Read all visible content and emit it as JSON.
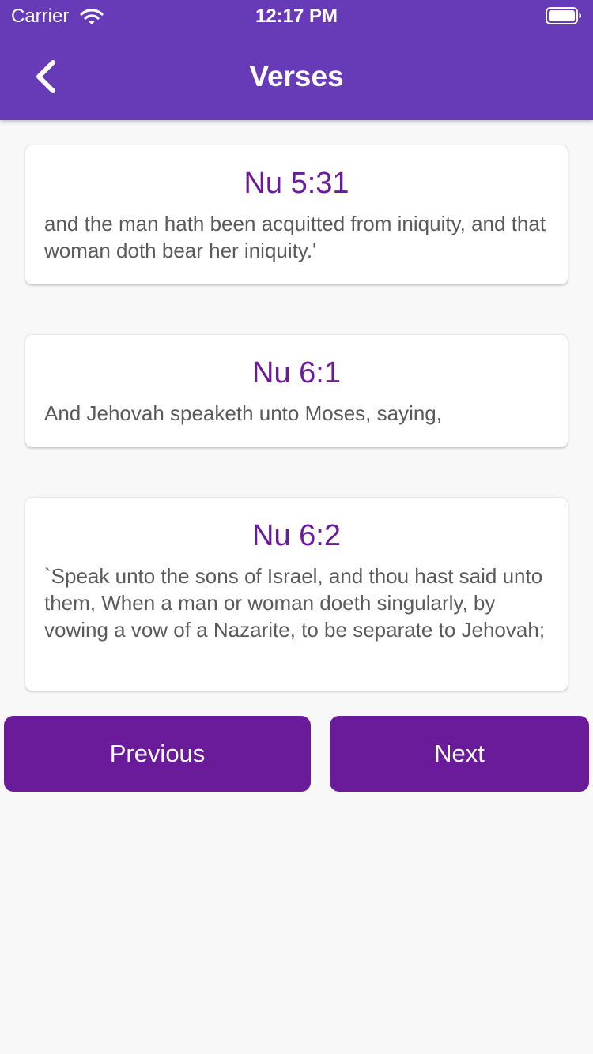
{
  "status_bar": {
    "carrier": "Carrier",
    "time": "12:17 PM",
    "wifi_icon": "wifi-icon",
    "battery_icon": "battery-icon"
  },
  "header": {
    "title": "Verses",
    "back_icon": "chevron-left-icon",
    "background": "#673ab7"
  },
  "verses": [
    {
      "reference": "Nu 5:31",
      "text": "and the man hath been acquitted from iniquity, and that woman doth bear her iniquity.'"
    },
    {
      "reference": "Nu 6:1",
      "text": "And Jehovah speaketh unto Moses, saying,"
    },
    {
      "reference": "Nu 6:2",
      "text": "`Speak unto the sons of Israel, and thou hast said unto them, When a man or woman doeth singularly, by vowing a vow of a Nazarite, to be separate to Jehovah;"
    }
  ],
  "buttons": {
    "previous": "Previous",
    "next": "Next"
  },
  "colors": {
    "accent": "#6a1b9a",
    "verse_text": "#5a5a5a",
    "page_background": "#f8f8f8"
  }
}
